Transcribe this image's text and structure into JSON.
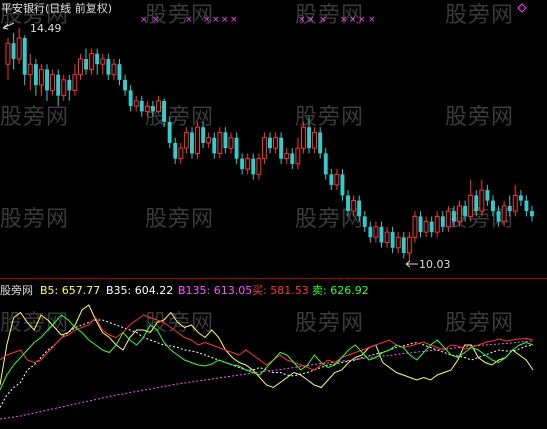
{
  "upper_panel": {
    "title": "平安银行(日线 前复权)",
    "high_label": "14.49",
    "low_label": "10.03"
  },
  "lower_panel": {
    "name": "股旁网",
    "legend": [
      {
        "key": "B5",
        "text": "B5: 657.77",
        "color": "#ffff66"
      },
      {
        "key": "B35",
        "text": "B35: 604.22",
        "color": "#ffffff"
      },
      {
        "key": "B135",
        "text": "B135: 613.05",
        "color": "#ff55ff"
      },
      {
        "key": "buy",
        "text": "买: 581.53",
        "color": "#ff3333"
      },
      {
        "key": "sell",
        "text": "卖: 626.92",
        "color": "#33ff33"
      }
    ]
  },
  "watermark": "股旁网",
  "colors": {
    "up": "#ff3333",
    "down": "#33cccc",
    "marker": "#ff44ff",
    "divider": "#b00000",
    "background": "#000000"
  },
  "chart_data": [
    {
      "type": "candlestick",
      "title": "平安银行(日线 前复权)",
      "annotations": [
        {
          "label": "14.49",
          "meaning": "period high"
        },
        {
          "label": "10.03",
          "meaning": "period low"
        }
      ],
      "price_range": [
        10.03,
        14.49
      ],
      "candles": [
        [
          13.8,
          14.2,
          14.3,
          13.5
        ],
        [
          14.2,
          13.9,
          14.4,
          13.7
        ],
        [
          13.9,
          14.3,
          14.49,
          13.8
        ],
        [
          14.3,
          13.6,
          14.35,
          13.4
        ],
        [
          13.6,
          13.8,
          14.0,
          13.3
        ],
        [
          13.8,
          13.4,
          13.9,
          13.2
        ],
        [
          13.4,
          13.7,
          13.8,
          13.2
        ],
        [
          13.7,
          13.3,
          13.8,
          13.1
        ],
        [
          13.3,
          13.6,
          13.7,
          13.2
        ],
        [
          13.6,
          13.2,
          13.7,
          13.0
        ],
        [
          13.2,
          13.5,
          13.6,
          13.1
        ],
        [
          13.5,
          13.3,
          13.6,
          13.1
        ],
        [
          13.3,
          13.6,
          13.8,
          13.2
        ],
        [
          13.6,
          13.9,
          14.0,
          13.5
        ],
        [
          13.9,
          13.7,
          14.1,
          13.6
        ],
        [
          13.7,
          14.0,
          14.1,
          13.6
        ],
        [
          14.0,
          13.8,
          14.1,
          13.6
        ],
        [
          13.8,
          13.9,
          14.0,
          13.6
        ],
        [
          13.9,
          13.6,
          14.0,
          13.5
        ],
        [
          13.6,
          13.8,
          13.9,
          13.5
        ],
        [
          13.8,
          13.5,
          13.9,
          13.4
        ],
        [
          13.5,
          13.3,
          13.6,
          13.2
        ],
        [
          13.3,
          13.0,
          13.4,
          12.9
        ],
        [
          13.0,
          13.1,
          13.2,
          12.9
        ],
        [
          13.1,
          12.9,
          13.2,
          12.8
        ],
        [
          12.9,
          13.0,
          13.1,
          12.8
        ],
        [
          13.0,
          12.9,
          13.1,
          12.8
        ],
        [
          12.9,
          13.1,
          13.2,
          12.85
        ],
        [
          13.1,
          12.7,
          13.15,
          12.6
        ],
        [
          12.7,
          12.3,
          12.8,
          12.2
        ],
        [
          12.3,
          12.0,
          12.4,
          11.9
        ],
        [
          12.0,
          12.2,
          12.3,
          11.9
        ],
        [
          12.2,
          12.5,
          12.6,
          12.1
        ],
        [
          12.5,
          12.1,
          12.6,
          12.0
        ],
        [
          12.1,
          12.6,
          12.7,
          12.0
        ],
        [
          12.6,
          12.3,
          12.7,
          12.2
        ],
        [
          12.3,
          12.4,
          12.5,
          12.2
        ],
        [
          12.4,
          12.1,
          12.5,
          12.0
        ],
        [
          12.1,
          12.5,
          12.6,
          12.0
        ],
        [
          12.5,
          12.2,
          12.6,
          12.1
        ],
        [
          12.2,
          12.4,
          12.5,
          12.1
        ],
        [
          12.4,
          12.0,
          12.5,
          11.9
        ],
        [
          12.0,
          11.8,
          12.1,
          11.7
        ],
        [
          11.8,
          12.0,
          12.1,
          11.7
        ],
        [
          12.0,
          11.7,
          12.1,
          11.6
        ],
        [
          11.7,
          12.0,
          12.1,
          11.6
        ],
        [
          12.0,
          12.4,
          12.5,
          11.9
        ],
        [
          12.4,
          12.2,
          12.5,
          12.1
        ],
        [
          12.2,
          12.4,
          12.5,
          12.1
        ],
        [
          12.4,
          12.0,
          12.5,
          11.9
        ],
        [
          12.0,
          12.1,
          12.2,
          11.9
        ],
        [
          12.1,
          11.9,
          12.2,
          11.8
        ],
        [
          11.9,
          12.2,
          12.4,
          11.8
        ],
        [
          12.2,
          12.6,
          12.7,
          12.1
        ],
        [
          12.6,
          12.2,
          12.8,
          12.1
        ],
        [
          12.2,
          12.5,
          12.6,
          12.1
        ],
        [
          12.5,
          12.1,
          12.6,
          12.0
        ],
        [
          12.1,
          11.7,
          12.2,
          11.6
        ],
        [
          11.7,
          11.5,
          11.8,
          11.4
        ],
        [
          11.5,
          11.7,
          11.8,
          11.4
        ],
        [
          11.7,
          11.3,
          11.8,
          11.2
        ],
        [
          11.3,
          11.0,
          11.4,
          10.9
        ],
        [
          11.0,
          11.2,
          11.3,
          10.9
        ],
        [
          11.2,
          10.9,
          11.3,
          10.8
        ],
        [
          10.9,
          10.7,
          11.0,
          10.6
        ],
        [
          10.7,
          10.5,
          10.8,
          10.4
        ],
        [
          10.5,
          10.7,
          10.8,
          10.4
        ],
        [
          10.7,
          10.4,
          10.8,
          10.3
        ],
        [
          10.4,
          10.6,
          10.7,
          10.3
        ],
        [
          10.6,
          10.3,
          10.7,
          10.2
        ],
        [
          10.3,
          10.5,
          10.6,
          10.2
        ],
        [
          10.5,
          10.2,
          10.6,
          10.1
        ],
        [
          10.2,
          10.5,
          10.6,
          10.03
        ],
        [
          10.5,
          10.9,
          11.0,
          10.4
        ],
        [
          10.9,
          10.6,
          11.0,
          10.5
        ],
        [
          10.6,
          10.8,
          10.9,
          10.5
        ],
        [
          10.8,
          10.6,
          10.9,
          10.5
        ],
        [
          10.6,
          10.9,
          11.0,
          10.5
        ],
        [
          10.9,
          10.7,
          11.0,
          10.6
        ],
        [
          10.7,
          11.0,
          11.1,
          10.6
        ],
        [
          11.0,
          10.8,
          11.1,
          10.7
        ],
        [
          10.8,
          11.1,
          11.2,
          10.7
        ],
        [
          11.1,
          10.9,
          11.2,
          10.8
        ],
        [
          10.9,
          11.3,
          11.6,
          10.8
        ],
        [
          11.3,
          11.0,
          11.4,
          10.9
        ],
        [
          11.0,
          11.4,
          11.6,
          10.9
        ],
        [
          11.4,
          11.2,
          11.5,
          11.1
        ],
        [
          11.2,
          11.0,
          11.3,
          10.9
        ],
        [
          11.0,
          10.8,
          11.1,
          10.7
        ],
        [
          10.8,
          11.1,
          11.2,
          10.7
        ],
        [
          11.1,
          11.0,
          11.3,
          10.9
        ],
        [
          11.0,
          11.3,
          11.5,
          10.9
        ],
        [
          11.3,
          11.2,
          11.4,
          11.1
        ],
        [
          11.2,
          11.0,
          11.3,
          10.9
        ],
        [
          11.0,
          10.9,
          11.1,
          10.8
        ]
      ]
    },
    {
      "type": "line",
      "series": [
        {
          "name": "B5",
          "values": [
            70,
            150,
            205,
            215,
            195,
            180,
            210,
            200,
            185,
            170,
            175,
            190,
            220,
            230,
            200,
            175,
            165,
            150,
            140,
            165,
            180,
            180,
            175,
            195,
            200,
            215,
            195,
            185,
            190,
            175,
            165,
            180,
            165,
            140,
            125,
            115,
            110,
            100,
            85,
            70,
            65,
            75,
            85,
            95,
            90,
            80,
            70,
            65,
            80,
            95,
            100,
            115,
            125,
            130,
            145,
            150,
            115,
            105,
            95,
            90,
            85,
            80,
            85,
            80,
            90,
            95,
            100,
            120,
            150,
            150,
            125,
            115,
            110,
            120,
            125,
            140,
            130,
            120,
            100
          ]
        },
        {
          "name": "B35",
          "values": [
            25,
            50,
            65,
            75,
            100,
            110,
            125,
            140,
            150,
            165,
            175,
            185,
            190,
            195,
            200,
            200,
            195,
            190,
            185,
            180,
            175,
            165,
            160,
            155,
            150,
            148,
            145,
            140,
            138,
            135,
            130,
            125,
            120,
            115,
            110,
            105,
            100,
            100,
            105,
            100,
            95,
            95,
            90,
            88,
            92,
            95,
            100,
            105,
            110,
            112,
            115,
            118,
            120,
            125,
            128,
            132,
            135,
            140,
            145,
            148,
            152,
            155,
            150,
            145,
            140,
            135,
            130,
            128,
            125,
            120,
            125,
            130,
            135,
            140,
            138,
            138,
            142,
            148,
            150
          ]
        },
        {
          "name": "B135",
          "values": [
            2,
            4,
            6,
            8,
            11,
            14,
            17,
            20,
            23,
            26,
            29,
            32,
            35,
            38,
            41,
            44,
            47,
            50,
            52,
            55,
            57,
            60,
            62,
            65,
            67,
            70,
            72,
            74,
            76,
            78,
            80,
            82,
            84,
            86,
            88,
            90,
            92,
            94,
            96,
            98,
            99,
            101,
            103,
            105,
            107,
            109,
            111,
            113,
            114,
            116,
            118,
            119,
            121,
            123,
            124,
            126,
            128,
            129,
            131,
            133,
            134,
            136,
            137,
            139,
            140,
            142,
            143,
            145,
            146,
            148,
            149,
            150,
            151,
            152,
            153,
            154,
            156,
            157,
            158
          ]
        },
        {
          "name": "买",
          "values": [
            120,
            130,
            135,
            140,
            120,
            115,
            120,
            135,
            150,
            165,
            170,
            180,
            185,
            190,
            205,
            180,
            170,
            165,
            175,
            190,
            200,
            210,
            205,
            200,
            195,
            185,
            175,
            165,
            160,
            150,
            155,
            150,
            145,
            140,
            135,
            130,
            140,
            130,
            120,
            110,
            120,
            130,
            120,
            115,
            110,
            105,
            100,
            110,
            120,
            115,
            125,
            130,
            135,
            140,
            145,
            150,
            155,
            160,
            150,
            145,
            148,
            152,
            156,
            150,
            145,
            140,
            150,
            148,
            142,
            145,
            150,
            155,
            158,
            162,
            158,
            160,
            162,
            163,
            160
          ]
        },
        {
          "name": "卖",
          "values": [
            60,
            90,
            110,
            125,
            140,
            155,
            165,
            180,
            195,
            210,
            200,
            185,
            175,
            160,
            150,
            140,
            135,
            150,
            175,
            160,
            150,
            165,
            190,
            180,
            155,
            140,
            130,
            120,
            115,
            110,
            108,
            112,
            120,
            115,
            110,
            108,
            100,
            95,
            90,
            105,
            120,
            135,
            130,
            115,
            100,
            110,
            130,
            115,
            105,
            110,
            125,
            140,
            150,
            135,
            120,
            125,
            135,
            140,
            150,
            145,
            130,
            120,
            135,
            150,
            160,
            145,
            130,
            125,
            135,
            145,
            140,
            130,
            120,
            115,
            125,
            140,
            150,
            155,
            150
          ]
        }
      ]
    }
  ]
}
